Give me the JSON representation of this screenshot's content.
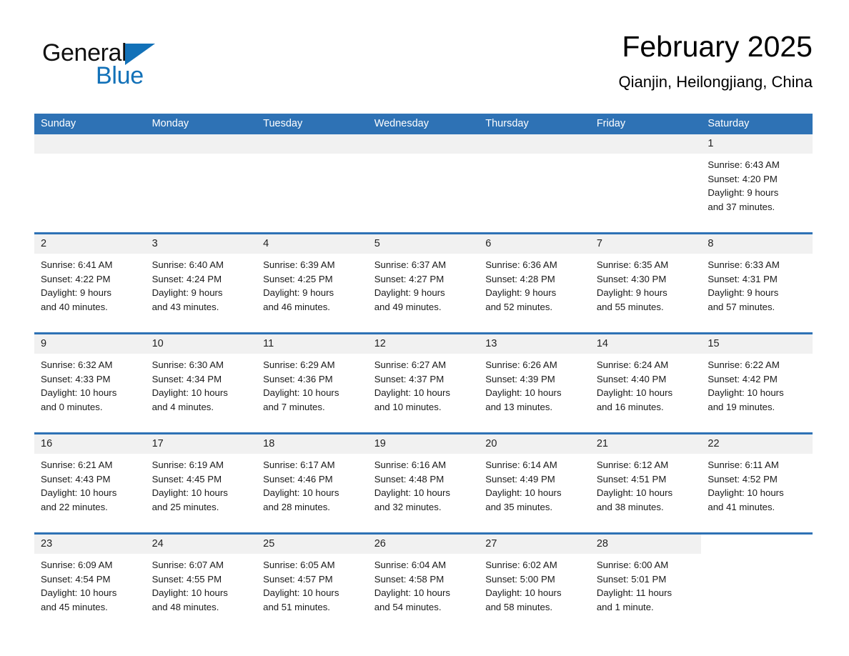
{
  "brand": {
    "name_part1": "General",
    "name_part2": "Blue",
    "triangle_color": "#1271b8"
  },
  "header": {
    "title": "February 2025",
    "subtitle": "Qianjin, Heilongjiang, China"
  },
  "theme": {
    "header_blue": "#2e72b5",
    "daynum_bg": "#f1f1f1",
    "text": "#1a1a1a"
  },
  "weekdays": [
    "Sunday",
    "Monday",
    "Tuesday",
    "Wednesday",
    "Thursday",
    "Friday",
    "Saturday"
  ],
  "weeks": [
    [
      {
        "day": "",
        "empty": true
      },
      {
        "day": "",
        "empty": true
      },
      {
        "day": "",
        "empty": true
      },
      {
        "day": "",
        "empty": true
      },
      {
        "day": "",
        "empty": true
      },
      {
        "day": "",
        "empty": true
      },
      {
        "day": "1",
        "sunrise": "Sunrise: 6:43 AM",
        "sunset": "Sunset: 4:20 PM",
        "daylight1": "Daylight: 9 hours",
        "daylight2": "and 37 minutes."
      }
    ],
    [
      {
        "day": "2",
        "sunrise": "Sunrise: 6:41 AM",
        "sunset": "Sunset: 4:22 PM",
        "daylight1": "Daylight: 9 hours",
        "daylight2": "and 40 minutes."
      },
      {
        "day": "3",
        "sunrise": "Sunrise: 6:40 AM",
        "sunset": "Sunset: 4:24 PM",
        "daylight1": "Daylight: 9 hours",
        "daylight2": "and 43 minutes."
      },
      {
        "day": "4",
        "sunrise": "Sunrise: 6:39 AM",
        "sunset": "Sunset: 4:25 PM",
        "daylight1": "Daylight: 9 hours",
        "daylight2": "and 46 minutes."
      },
      {
        "day": "5",
        "sunrise": "Sunrise: 6:37 AM",
        "sunset": "Sunset: 4:27 PM",
        "daylight1": "Daylight: 9 hours",
        "daylight2": "and 49 minutes."
      },
      {
        "day": "6",
        "sunrise": "Sunrise: 6:36 AM",
        "sunset": "Sunset: 4:28 PM",
        "daylight1": "Daylight: 9 hours",
        "daylight2": "and 52 minutes."
      },
      {
        "day": "7",
        "sunrise": "Sunrise: 6:35 AM",
        "sunset": "Sunset: 4:30 PM",
        "daylight1": "Daylight: 9 hours",
        "daylight2": "and 55 minutes."
      },
      {
        "day": "8",
        "sunrise": "Sunrise: 6:33 AM",
        "sunset": "Sunset: 4:31 PM",
        "daylight1": "Daylight: 9 hours",
        "daylight2": "and 57 minutes."
      }
    ],
    [
      {
        "day": "9",
        "sunrise": "Sunrise: 6:32 AM",
        "sunset": "Sunset: 4:33 PM",
        "daylight1": "Daylight: 10 hours",
        "daylight2": "and 0 minutes."
      },
      {
        "day": "10",
        "sunrise": "Sunrise: 6:30 AM",
        "sunset": "Sunset: 4:34 PM",
        "daylight1": "Daylight: 10 hours",
        "daylight2": "and 4 minutes."
      },
      {
        "day": "11",
        "sunrise": "Sunrise: 6:29 AM",
        "sunset": "Sunset: 4:36 PM",
        "daylight1": "Daylight: 10 hours",
        "daylight2": "and 7 minutes."
      },
      {
        "day": "12",
        "sunrise": "Sunrise: 6:27 AM",
        "sunset": "Sunset: 4:37 PM",
        "daylight1": "Daylight: 10 hours",
        "daylight2": "and 10 minutes."
      },
      {
        "day": "13",
        "sunrise": "Sunrise: 6:26 AM",
        "sunset": "Sunset: 4:39 PM",
        "daylight1": "Daylight: 10 hours",
        "daylight2": "and 13 minutes."
      },
      {
        "day": "14",
        "sunrise": "Sunrise: 6:24 AM",
        "sunset": "Sunset: 4:40 PM",
        "daylight1": "Daylight: 10 hours",
        "daylight2": "and 16 minutes."
      },
      {
        "day": "15",
        "sunrise": "Sunrise: 6:22 AM",
        "sunset": "Sunset: 4:42 PM",
        "daylight1": "Daylight: 10 hours",
        "daylight2": "and 19 minutes."
      }
    ],
    [
      {
        "day": "16",
        "sunrise": "Sunrise: 6:21 AM",
        "sunset": "Sunset: 4:43 PM",
        "daylight1": "Daylight: 10 hours",
        "daylight2": "and 22 minutes."
      },
      {
        "day": "17",
        "sunrise": "Sunrise: 6:19 AM",
        "sunset": "Sunset: 4:45 PM",
        "daylight1": "Daylight: 10 hours",
        "daylight2": "and 25 minutes."
      },
      {
        "day": "18",
        "sunrise": "Sunrise: 6:17 AM",
        "sunset": "Sunset: 4:46 PM",
        "daylight1": "Daylight: 10 hours",
        "daylight2": "and 28 minutes."
      },
      {
        "day": "19",
        "sunrise": "Sunrise: 6:16 AM",
        "sunset": "Sunset: 4:48 PM",
        "daylight1": "Daylight: 10 hours",
        "daylight2": "and 32 minutes."
      },
      {
        "day": "20",
        "sunrise": "Sunrise: 6:14 AM",
        "sunset": "Sunset: 4:49 PM",
        "daylight1": "Daylight: 10 hours",
        "daylight2": "and 35 minutes."
      },
      {
        "day": "21",
        "sunrise": "Sunrise: 6:12 AM",
        "sunset": "Sunset: 4:51 PM",
        "daylight1": "Daylight: 10 hours",
        "daylight2": "and 38 minutes."
      },
      {
        "day": "22",
        "sunrise": "Sunrise: 6:11 AM",
        "sunset": "Sunset: 4:52 PM",
        "daylight1": "Daylight: 10 hours",
        "daylight2": "and 41 minutes."
      }
    ],
    [
      {
        "day": "23",
        "sunrise": "Sunrise: 6:09 AM",
        "sunset": "Sunset: 4:54 PM",
        "daylight1": "Daylight: 10 hours",
        "daylight2": "and 45 minutes."
      },
      {
        "day": "24",
        "sunrise": "Sunrise: 6:07 AM",
        "sunset": "Sunset: 4:55 PM",
        "daylight1": "Daylight: 10 hours",
        "daylight2": "and 48 minutes."
      },
      {
        "day": "25",
        "sunrise": "Sunrise: 6:05 AM",
        "sunset": "Sunset: 4:57 PM",
        "daylight1": "Daylight: 10 hours",
        "daylight2": "and 51 minutes."
      },
      {
        "day": "26",
        "sunrise": "Sunrise: 6:04 AM",
        "sunset": "Sunset: 4:58 PM",
        "daylight1": "Daylight: 10 hours",
        "daylight2": "and 54 minutes."
      },
      {
        "day": "27",
        "sunrise": "Sunrise: 6:02 AM",
        "sunset": "Sunset: 5:00 PM",
        "daylight1": "Daylight: 10 hours",
        "daylight2": "and 58 minutes."
      },
      {
        "day": "28",
        "sunrise": "Sunrise: 6:00 AM",
        "sunset": "Sunset: 5:01 PM",
        "daylight1": "Daylight: 11 hours",
        "daylight2": "and 1 minute."
      },
      {
        "day": "",
        "nodata": true
      }
    ]
  ]
}
